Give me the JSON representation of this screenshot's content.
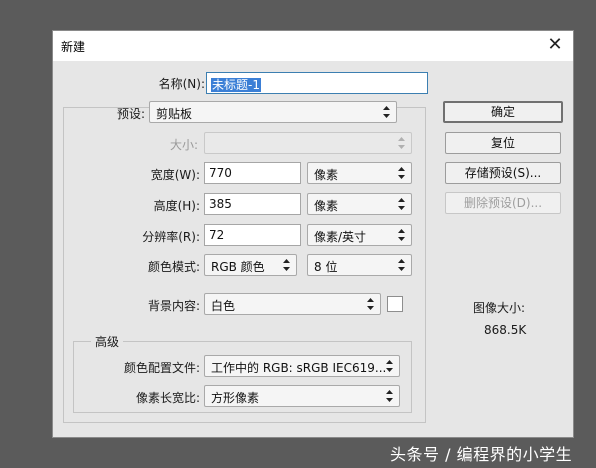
{
  "window": {
    "title": "新建",
    "close_glyph": "✕"
  },
  "form": {
    "name_label": "名称(N):",
    "name_value": "未标题-1",
    "preset_label": "预设:",
    "preset_value": "剪贴板",
    "size_label": "大小:",
    "size_value": "",
    "width_label": "宽度(W):",
    "width_value": "770",
    "width_unit": "像素",
    "height_label": "高度(H):",
    "height_value": "385",
    "height_unit": "像素",
    "resolution_label": "分辨率(R):",
    "resolution_value": "72",
    "resolution_unit": "像素/英寸",
    "color_mode_label": "颜色模式:",
    "color_mode_value": "RGB 颜色",
    "bit_depth_value": "8 位",
    "background_label": "背景内容:",
    "background_value": "白色",
    "background_swatch_color": "#ffffff"
  },
  "advanced": {
    "legend": "高级",
    "color_profile_label": "颜色配置文件:",
    "color_profile_value": "工作中的 RGB: sRGB IEC619...",
    "pixel_aspect_label": "像素长宽比:",
    "pixel_aspect_value": "方形像素"
  },
  "buttons": {
    "ok": "确定",
    "reset": "复位",
    "save_preset": "存储预设(S)...",
    "delete_preset": "删除预设(D)..."
  },
  "image_size": {
    "label": "图像大小:",
    "value": "868.5K"
  },
  "watermark": "头条号 / 编程界的小学生",
  "colors": {
    "backdrop": "#5b5b5b",
    "dialog_bg": "#e6e6e6",
    "selection": "#3b7fd6"
  }
}
